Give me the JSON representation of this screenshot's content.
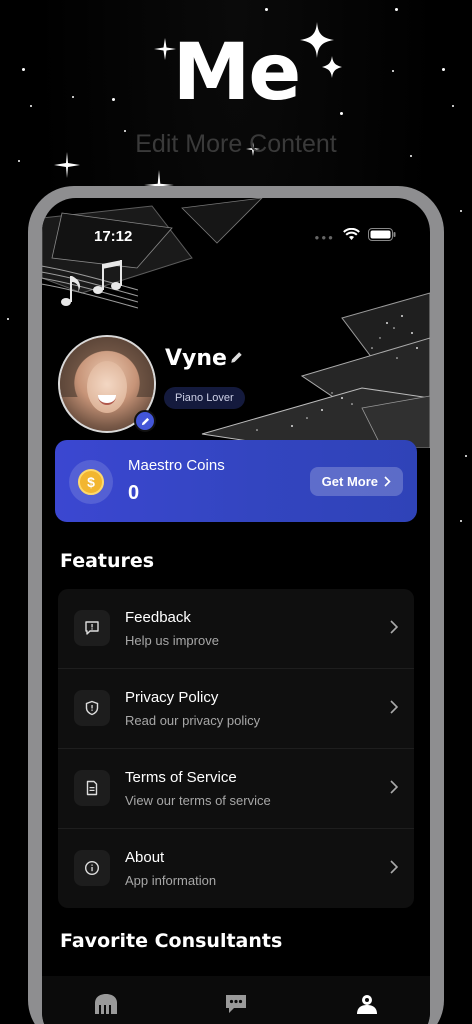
{
  "promo": {
    "title": "Me",
    "subtitle": "Edit More Content"
  },
  "status_bar": {
    "time": "17:12"
  },
  "profile": {
    "name": "Vyne",
    "tag": "Piano Lover"
  },
  "coins": {
    "label": "Maestro Coins",
    "value": "0",
    "button_label": "Get More",
    "icon": "dollar-coin-icon"
  },
  "features": {
    "title": "Features",
    "items": [
      {
        "title": "Feedback",
        "subtitle": "Help us improve",
        "icon": "feedback-icon"
      },
      {
        "title": "Privacy Policy",
        "subtitle": "Read our privacy policy",
        "icon": "shield-icon"
      },
      {
        "title": "Terms of Service",
        "subtitle": "View our terms of service",
        "icon": "document-icon"
      },
      {
        "title": "About",
        "subtitle": "App information",
        "icon": "info-icon"
      }
    ]
  },
  "favorites": {
    "title": "Favorite Consultants"
  },
  "tab_bar": {
    "items": [
      {
        "icon": "piano-icon",
        "active": false
      },
      {
        "icon": "chat-icon",
        "active": false
      },
      {
        "icon": "profile-icon",
        "active": true
      }
    ]
  },
  "colors": {
    "accent": "#3b47d1",
    "background": "#000000",
    "frame": "#8e8e90"
  }
}
